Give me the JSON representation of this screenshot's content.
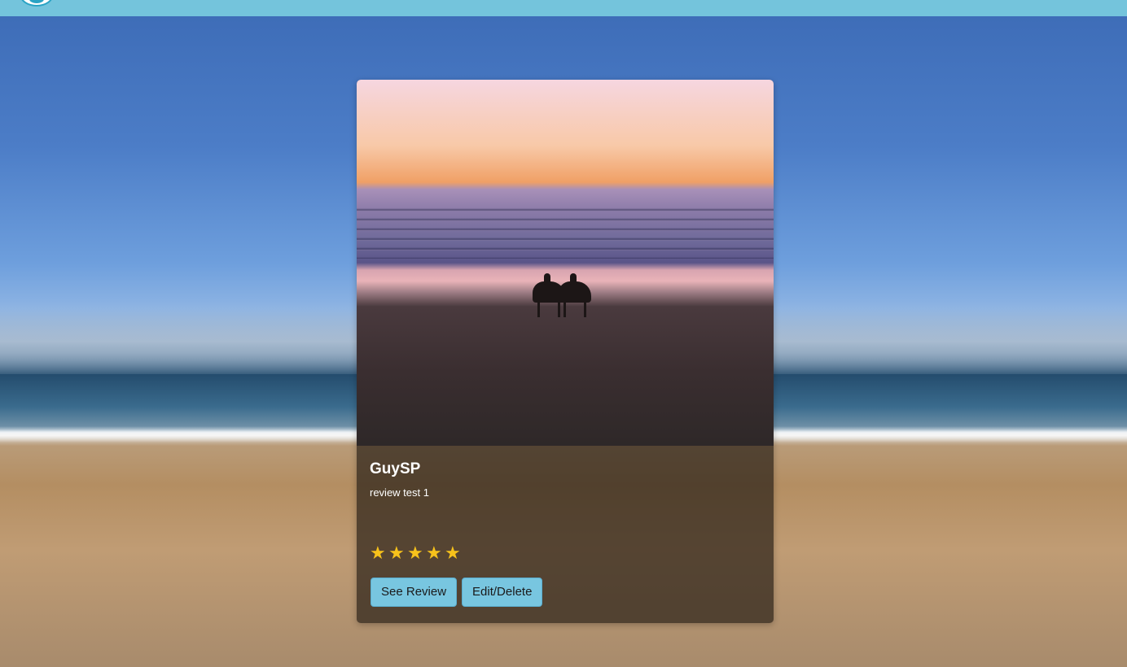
{
  "navbar": {
    "logo": "site-logo"
  },
  "card": {
    "title": "GuySP",
    "text": "review test 1",
    "rating": 5,
    "rating_max": 5,
    "star_glyph": "★",
    "star_color": "#f7c21b",
    "buttons": {
      "see_review": "See Review",
      "edit_delete": "Edit/Delete"
    }
  },
  "colors": {
    "navbar": "#74c4dc",
    "button": "#78c6e0"
  }
}
